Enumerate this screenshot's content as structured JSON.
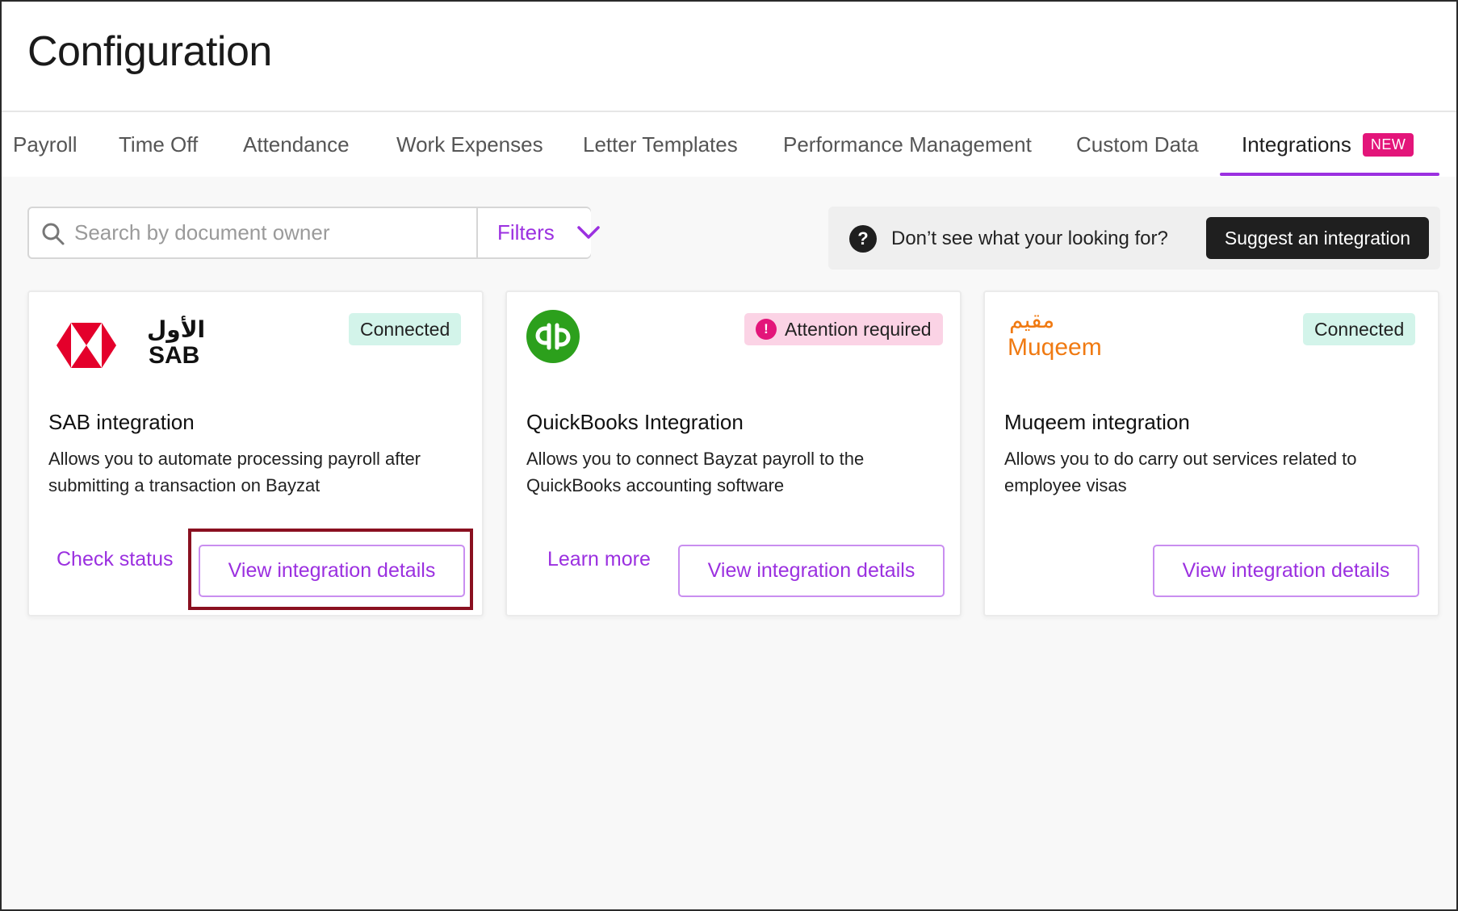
{
  "page": {
    "title": "Configuration"
  },
  "tabs": [
    {
      "label": "Payroll"
    },
    {
      "label": "Time Off"
    },
    {
      "label": "Attendance"
    },
    {
      "label": "Work Expenses"
    },
    {
      "label": "Letter Templates"
    },
    {
      "label": "Performance Management"
    },
    {
      "label": "Custom Data"
    },
    {
      "label": "Integrations",
      "badge": "NEW",
      "active": true
    }
  ],
  "toolbar": {
    "search_placeholder": "Search by document owner",
    "filters_label": "Filters",
    "help_text": "Don’t see what your looking for?",
    "suggest_label": "Suggest an integration"
  },
  "cards": [
    {
      "logo": {
        "arabic": "الأول",
        "latin": "SAB"
      },
      "status": "Connected",
      "title": "SAB integration",
      "description": "Allows you to automate processing payroll after submitting a transaction on Bayzat",
      "link_label": "Check status",
      "button_label": "View integration details"
    },
    {
      "logo": {
        "latin": "qb"
      },
      "status": "Attention required",
      "title": "QuickBooks Integration",
      "description": "Allows you to connect Bayzat payroll to the QuickBooks accounting software",
      "link_label": "Learn more",
      "button_label": "View integration details"
    },
    {
      "logo": {
        "arabic": "مقيم",
        "latin": "Muqeem"
      },
      "status": "Connected",
      "title": "Muqeem integration",
      "description": "Allows you to do carry out services related to employee visas",
      "button_label": "View integration details"
    }
  ],
  "colors": {
    "accent": "#9b30e0",
    "new_badge": "#e3157a",
    "connected_bg": "#d3f4ea",
    "attention_bg": "#fbd3e5",
    "sab_red": "#e4002b",
    "quickbooks_green": "#2ca01c",
    "muqeem_orange": "#f07a12",
    "highlight": "#8a1020"
  }
}
